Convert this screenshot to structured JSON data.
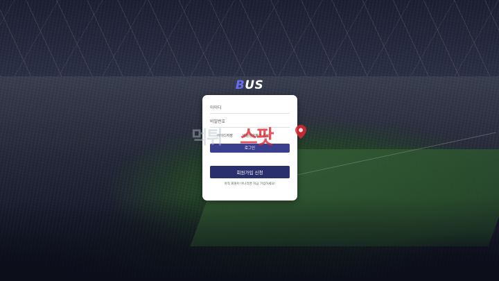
{
  "brand": {
    "logo_first": "B",
    "logo_rest": "US",
    "logo_accent": "#6a6cf0"
  },
  "login_form": {
    "id_placeholder": "아이디",
    "password_placeholder": "비밀번호",
    "save_id_label": "아이디저장",
    "find_password_label": "비밀번호찾기 클릭",
    "login_button": "로그인",
    "signup_button": "회원가입 신청",
    "signup_hint": "아직 회원이 아니라면 지금 가입하세요!"
  },
  "watermark": {
    "text_grey": "먹튀",
    "text_red": "스팟"
  },
  "colors": {
    "login_button": "#3b3f8f",
    "signup_button": "#2a2f6e",
    "card": "#ffffff"
  }
}
